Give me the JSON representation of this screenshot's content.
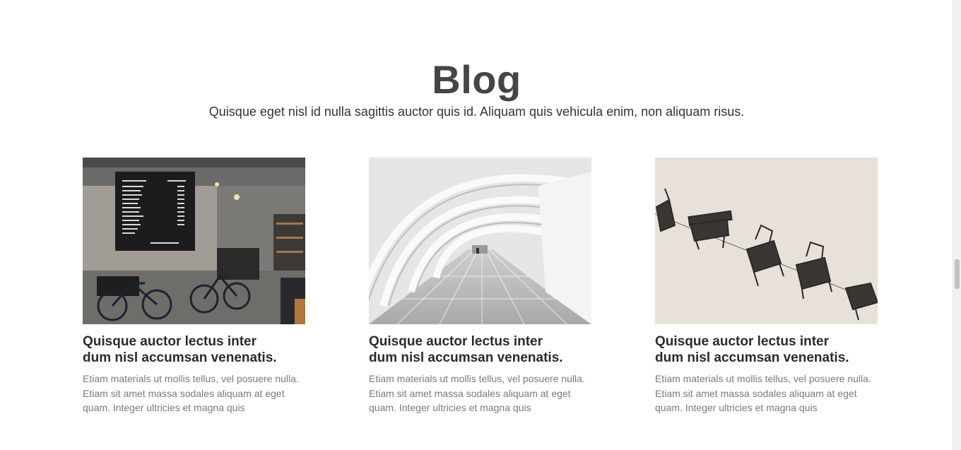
{
  "section": {
    "title": "Blog",
    "subtitle": "Quisque eget nisl id nulla sagittis auctor quis id. Aliquam quis vehicula enim, non aliquam risus."
  },
  "posts": [
    {
      "title_line1": "Quisque auctor lectus inter",
      "title_line2": "dum nisl accumsan venenatis.",
      "excerpt_line1": "Etiam materials ut mollis tellus, vel posuere nulla.",
      "excerpt_line2": "Etiam sit amet massa sodales aliquam at eget",
      "excerpt_line3": "quam. Integer ultricies et magna quis",
      "image": "cafe-with-bicycles-photo"
    },
    {
      "title_line1": "Quisque auctor lectus inter",
      "title_line2": "dum nisl accumsan venenatis.",
      "excerpt_line1": "Etiam materials ut mollis tellus, vel posuere nulla.",
      "excerpt_line2": "Etiam sit amet massa sodales aliquam at eget",
      "excerpt_line3": "quam. Integer ultricies et magna quis",
      "image": "white-arched-corridor-photo"
    },
    {
      "title_line1": "Quisque auctor lectus inter",
      "title_line2": "dum nisl accumsan venenatis.",
      "excerpt_line1": "Etiam materials ut mollis tellus, vel posuere nulla.",
      "excerpt_line2": "Etiam sit amet massa sodales aliquam at eget",
      "excerpt_line3": "quam. Integer ultricies et magna quis",
      "image": "hanging-chairs-photo"
    }
  ],
  "colors": {
    "title": "#454545",
    "subtitle": "#333333",
    "card_title": "#2b2b2b",
    "excerpt": "#7a7a7a"
  }
}
